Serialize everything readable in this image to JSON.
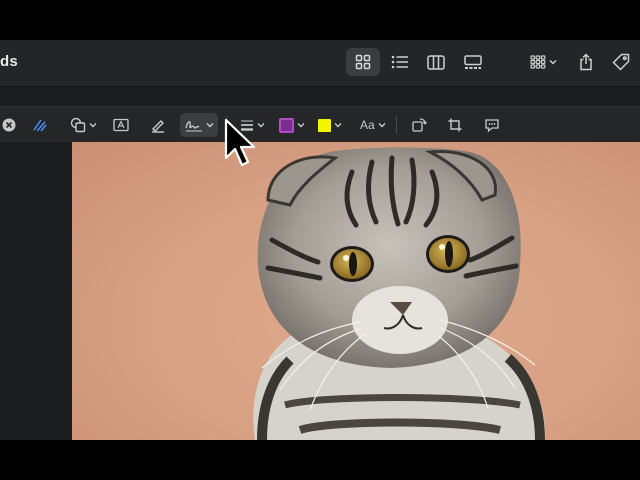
{
  "window": {
    "title_fragment": "ds"
  },
  "toolbar": {
    "buttons": [
      {
        "name": "view-grid",
        "icon": "grid-icon",
        "active": true
      },
      {
        "name": "view-list",
        "icon": "list-icon",
        "active": false
      },
      {
        "name": "view-columns",
        "icon": "columns-icon",
        "active": false
      },
      {
        "name": "view-gallery",
        "icon": "gallery-icon",
        "active": false
      },
      {
        "name": "group-menu",
        "icon": "group-grid-icon",
        "active": false
      },
      {
        "name": "share",
        "icon": "share-icon",
        "active": false
      },
      {
        "name": "tags",
        "icon": "tag-icon",
        "active": false
      }
    ]
  },
  "markup": {
    "font_label": "Aa",
    "border_color": "#b04cc8",
    "fill_color": "#f5f500",
    "active_tool": "signature"
  },
  "image": {
    "subject": "scottish-fold-cat",
    "background_color": "#d9a184"
  }
}
